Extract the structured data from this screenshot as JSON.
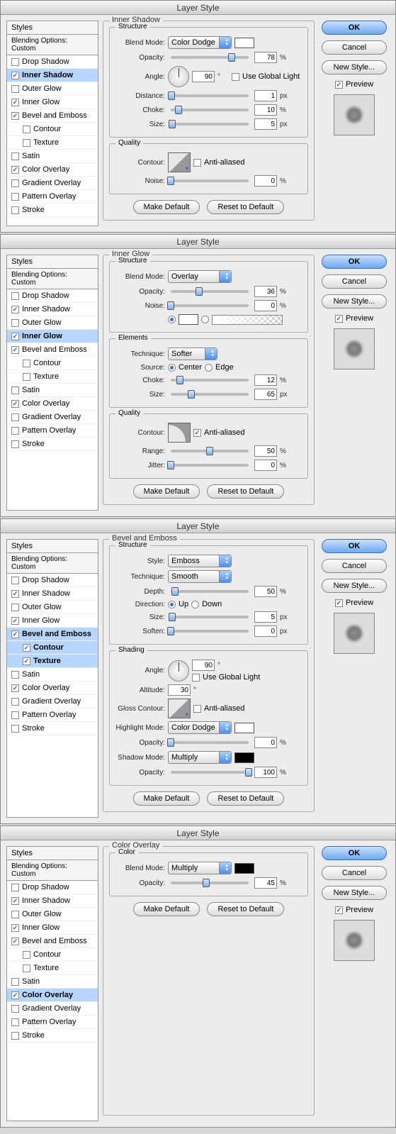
{
  "title": "Layer Style",
  "styles_header": "Styles",
  "blending_options": "Blending Options: Custom",
  "style_items": [
    {
      "label": "Drop Shadow"
    },
    {
      "label": "Inner Shadow"
    },
    {
      "label": "Outer Glow"
    },
    {
      "label": "Inner Glow"
    },
    {
      "label": "Bevel and Emboss"
    },
    {
      "label": "Contour"
    },
    {
      "label": "Texture"
    },
    {
      "label": "Satin"
    },
    {
      "label": "Color Overlay"
    },
    {
      "label": "Gradient Overlay"
    },
    {
      "label": "Pattern Overlay"
    },
    {
      "label": "Stroke"
    }
  ],
  "buttons": {
    "ok": "OK",
    "cancel": "Cancel",
    "new_style": "New Style...",
    "preview": "Preview",
    "make_default": "Make Default",
    "reset_default": "Reset to Default"
  },
  "labels": {
    "blend_mode": "Blend Mode:",
    "opacity": "Opacity:",
    "angle": "Angle:",
    "use_global_light": "Use Global Light",
    "distance": "Distance:",
    "choke": "Choke:",
    "size": "Size:",
    "contour": "Contour:",
    "anti_aliased": "Anti-aliased",
    "noise": "Noise:",
    "technique": "Technique:",
    "source": "Source:",
    "center": "Center",
    "edge": "Edge",
    "range": "Range:",
    "jitter": "Jitter:",
    "style": "Style:",
    "depth": "Depth:",
    "direction": "Direction:",
    "up": "Up",
    "down": "Down",
    "soften": "Soften:",
    "altitude": "Altitude:",
    "gloss_contour": "Gloss Contour:",
    "highlight_mode": "Highlight Mode:",
    "shadow_mode": "Shadow Mode:"
  },
  "groups": {
    "structure": "Structure",
    "quality": "Quality",
    "elements": "Elements",
    "shading": "Shading",
    "color": "Color",
    "inner_shadow": "Inner Shadow",
    "inner_glow": "Inner Glow",
    "bevel_emboss": "Bevel and Emboss",
    "color_overlay": "Color Overlay"
  },
  "panels": [
    {
      "selected": "Inner Shadow",
      "checked": [
        "Inner Shadow",
        "Inner Glow",
        "Bevel and Emboss",
        "Color Overlay"
      ],
      "inner_shadow": {
        "blend_mode": "Color Dodge",
        "opacity": 78,
        "angle": 90,
        "use_global": false,
        "distance": 1,
        "distance_unit": "px",
        "choke": 10,
        "choke_unit": "%",
        "size": 5,
        "size_unit": "px",
        "anti_aliased": false,
        "noise": 0,
        "noise_unit": "%"
      }
    },
    {
      "selected": "Inner Glow",
      "checked": [
        "Inner Shadow",
        "Inner Glow",
        "Bevel and Emboss",
        "Color Overlay"
      ],
      "inner_glow": {
        "blend_mode": "Overlay",
        "opacity": 36,
        "opacity_unit": "%",
        "noise": 0,
        "noise_unit": "%",
        "color_mode": "solid",
        "technique": "Softer",
        "source": "Center",
        "choke": 12,
        "choke_unit": "%",
        "size": 65,
        "size_unit": "px",
        "anti_aliased": true,
        "range": 50,
        "range_unit": "%",
        "jitter": 0,
        "jitter_unit": "%"
      }
    },
    {
      "selected": "Bevel and Emboss",
      "checked": [
        "Inner Shadow",
        "Inner Glow",
        "Bevel and Emboss",
        "Contour",
        "Texture",
        "Color Overlay"
      ],
      "bevel": {
        "style": "Emboss",
        "technique": "Smooth",
        "depth": 50,
        "depth_unit": "%",
        "direction": "Up",
        "size": 5,
        "size_unit": "px",
        "soften": 0,
        "soften_unit": "px",
        "angle": 90,
        "use_global": false,
        "altitude": 30,
        "anti_aliased": false,
        "highlight_mode": "Color Dodge",
        "highlight_opacity": 0,
        "ho_unit": "%",
        "shadow_mode": "Multiply",
        "shadow_opacity": 100,
        "so_unit": "%"
      }
    },
    {
      "selected": "Color Overlay",
      "checked": [
        "Inner Shadow",
        "Inner Glow",
        "Bevel and Emboss",
        "Color Overlay"
      ],
      "color_overlay": {
        "blend_mode": "Multiply",
        "opacity": 45,
        "opacity_unit": "%"
      }
    }
  ]
}
